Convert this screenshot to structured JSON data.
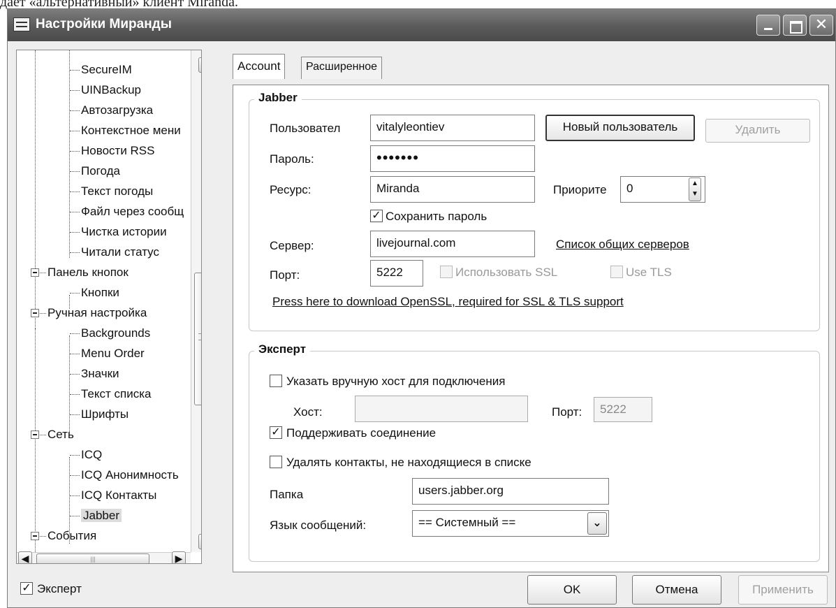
{
  "caption": "дает «альтернативный» клиент Miranda.",
  "window": {
    "title": "Настройки Миранды"
  },
  "tree": {
    "items": [
      {
        "label": "SecureIM"
      },
      {
        "label": "UINBackup"
      },
      {
        "label": "Автозагрузка"
      },
      {
        "label": "Контекстное мени"
      },
      {
        "label": "Новости RSS"
      },
      {
        "label": "Погода"
      },
      {
        "label": "Текст погоды"
      },
      {
        "label": "Файл через сообщ"
      },
      {
        "label": "Чистка истории"
      },
      {
        "label": "Читали статус"
      },
      {
        "label": "Панель кнопок"
      },
      {
        "label": "Кнопки"
      },
      {
        "label": "Ручная настройка"
      },
      {
        "label": "Backgrounds"
      },
      {
        "label": "Menu Order"
      },
      {
        "label": "Значки"
      },
      {
        "label": "Текст списка"
      },
      {
        "label": "Шрифты"
      },
      {
        "label": "Сеть"
      },
      {
        "label": "ICQ"
      },
      {
        "label": "ICQ Анонимность"
      },
      {
        "label": "ICQ Контакты"
      },
      {
        "label": "Jabber"
      },
      {
        "label": "События"
      }
    ],
    "selected": "Jabber"
  },
  "expert_checkbox": {
    "label": "Эксперт",
    "checked": true
  },
  "tabs": [
    {
      "label": "Account",
      "active": true
    },
    {
      "label": "Расширенное",
      "active": false
    }
  ],
  "jabber": {
    "group_title": "Jabber",
    "user_label": "Пользовател",
    "user_value": "vitalyleontiev",
    "new_user_button": "Новый пользователь",
    "delete_button": "Удалить",
    "password_label": "Пароль:",
    "password_value": "•••••••",
    "resource_label": "Ресурс:",
    "resource_value": "Miranda",
    "priority_label": "Приорите",
    "priority_value": "0",
    "save_password_label": "Сохранить пароль",
    "save_password_checked": true,
    "server_label": "Сервер:",
    "server_value": "livejournal.com",
    "server_list_link": "Список общих серверов",
    "port_label": "Порт:",
    "port_value": "5222",
    "use_ssl_label": "Использовать SSL",
    "use_tls_label": "Use TLS",
    "openssl_link": "Press here to download OpenSSL, required for SSL & TLS support"
  },
  "expert": {
    "group_title": "Эксперт",
    "manual_host_label": "Указать вручную хост для подключения",
    "manual_host_checked": false,
    "host_label": "Хост:",
    "host_value": "",
    "port_label": "Порт:",
    "port_value": "5222",
    "keepalive_label": "Поддерживать соединение",
    "keepalive_checked": true,
    "remove_contacts_label": "Удалять контакты, не находящиеся в списке",
    "remove_contacts_checked": false,
    "folder_label": "Папка",
    "folder_value": "users.jabber.org",
    "language_label": "Язык сообщений:",
    "language_value": "== Системный =="
  },
  "buttons": {
    "ok": "OK",
    "cancel": "Отмена",
    "apply": "Применить"
  },
  "colors": {
    "titlebar": "#5a5a5a",
    "window_bg": "#eeeeee",
    "panel_bg": "#ffffff"
  }
}
